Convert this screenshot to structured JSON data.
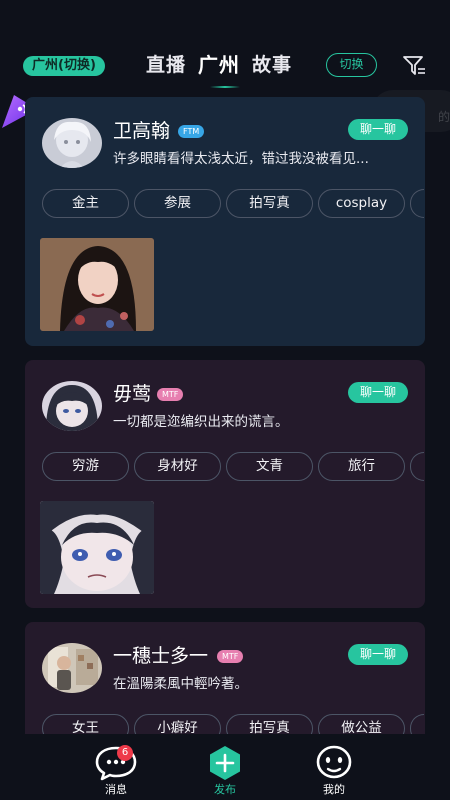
{
  "header": {
    "location_pill": "广州(切换)",
    "tabs": [
      {
        "label": "直播",
        "active": false
      },
      {
        "label": "广州",
        "active": true
      },
      {
        "label": "故事",
        "active": false
      }
    ],
    "switch_label": "切换",
    "filter_icon": "filter-icon"
  },
  "side_hint": "的",
  "cards": [
    {
      "name": "卫高翰",
      "gender_badge": "FTM",
      "chat_label": "聊一聊",
      "bio": "许多眼睛看得太浅太近，错过我没被看见...",
      "tags": [
        "金主",
        "参展",
        "拍写真",
        "cosplay"
      ]
    },
    {
      "name": "毋莺",
      "gender_badge": "MTF",
      "chat_label": "聊一聊",
      "bio": "一切都是迩编织出来的谎言。",
      "tags": [
        "穷游",
        "身材好",
        "文青",
        "旅行"
      ]
    },
    {
      "name": "一穗士多一",
      "gender_badge": "MTF",
      "chat_label": "聊一聊",
      "bio": "在溫陽柔風中輕吟著。",
      "tags": [
        "女王",
        "小癖好",
        "拍写真",
        "做公益"
      ]
    }
  ],
  "bottom_nav": {
    "items": [
      {
        "label": "消息",
        "icon": "message-bubble-icon",
        "badge": "6"
      },
      {
        "label": "发布",
        "icon": "publish-plus-icon",
        "active": true
      },
      {
        "label": "我的",
        "icon": "profile-face-icon"
      }
    ]
  },
  "colors": {
    "accent": "#27c59f",
    "background": "#0e111a",
    "card_blue": "#18283b",
    "card_purple": "#241a2b",
    "badge_red": "#ee3a4a"
  }
}
